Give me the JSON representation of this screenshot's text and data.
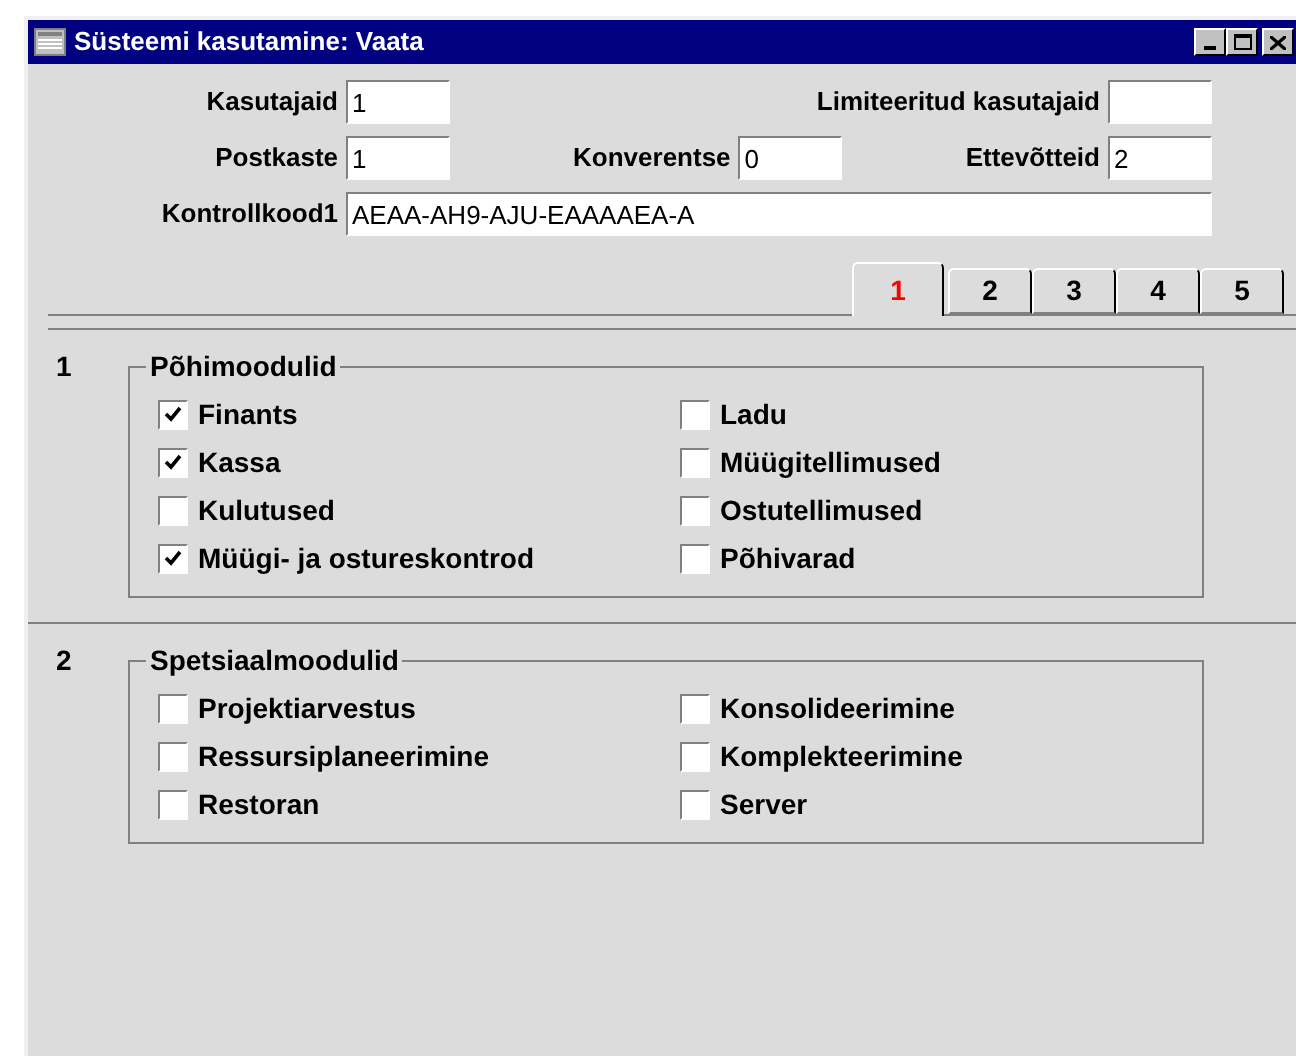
{
  "window": {
    "title": "Süsteemi kasutamine: Vaata"
  },
  "field_rows": [
    [
      {
        "label": "Kasutajaid",
        "value": "1"
      },
      {
        "label": "Limiteeritud kasutajaid"
      }
    ],
    [
      {
        "label": "Postkaste",
        "value": "1"
      },
      {
        "label": "Konverentse",
        "value": "0"
      },
      {
        "label": "Ettevõtteid",
        "value": "2"
      }
    ],
    [
      {
        "label": "Kontrollkood1",
        "value": "AEAA-AH9-AJU-EAAAAEA-A"
      }
    ]
  ],
  "tabs": [
    {
      "label": "1",
      "selected": true
    },
    {
      "label": "2",
      "selected": false
    },
    {
      "label": "3",
      "selected": false
    },
    {
      "label": "4",
      "selected": false
    },
    {
      "label": "5",
      "selected": false
    }
  ],
  "sections": [
    {
      "number": "1",
      "title": "Põhimoodulid",
      "columns": [
        [
          {
            "label": "Finants",
            "checked": true
          },
          {
            "label": "Kassa",
            "checked": true
          },
          {
            "label": "Kulutused",
            "checked": false
          },
          {
            "label": "Müügi- ja ostureskontrod",
            "checked": true
          }
        ],
        [
          {
            "label": "Ladu",
            "checked": false
          },
          {
            "label": "Müügitellimused",
            "checked": false
          },
          {
            "label": "Ostutellimused",
            "checked": false
          },
          {
            "label": "Põhivarad",
            "checked": false
          }
        ]
      ]
    },
    {
      "number": "2",
      "title": "Spetsiaalmoodulid",
      "columns": [
        [
          {
            "label": "Projektiarvestus",
            "checked": false
          },
          {
            "label": "Ressursiplaneerimine",
            "checked": false
          },
          {
            "label": "Restoran",
            "checked": false
          }
        ],
        [
          {
            "label": "Konsolideerimine",
            "checked": false
          },
          {
            "label": "Komplekteerimine",
            "checked": false
          },
          {
            "label": "Server",
            "checked": false
          }
        ]
      ]
    }
  ]
}
